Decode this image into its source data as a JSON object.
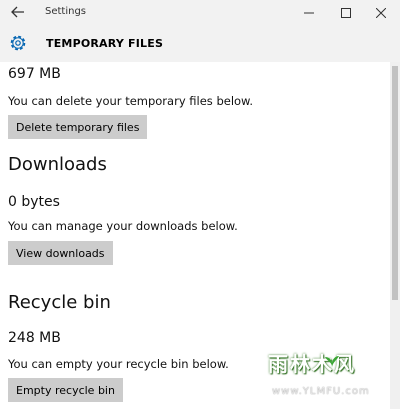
{
  "window": {
    "title": "Settings",
    "back_icon": "back-arrow-icon",
    "minimize_icon": "minimize-icon",
    "maximize_icon": "maximize-icon",
    "close_icon": "close-icon"
  },
  "header": {
    "icon": "gear-icon",
    "title": "TEMPORARY FILES"
  },
  "temporary": {
    "size": "697 MB",
    "description": "You can delete your temporary files below.",
    "button_label": "Delete temporary files"
  },
  "downloads": {
    "heading": "Downloads",
    "size": "0 bytes",
    "description": "You can manage your downloads below.",
    "button_label": "View downloads"
  },
  "recycle": {
    "heading": "Recycle bin",
    "size": "248 MB",
    "description": "You can empty your recycle bin below.",
    "button_label": "Empty recycle bin"
  },
  "watermark": {
    "text": "雨林木风",
    "url": "www.YLMFU.com"
  },
  "colors": {
    "accent": "#0063b1",
    "button_bg": "#cccccc",
    "titlebar_bg": "#f2f2f2"
  }
}
